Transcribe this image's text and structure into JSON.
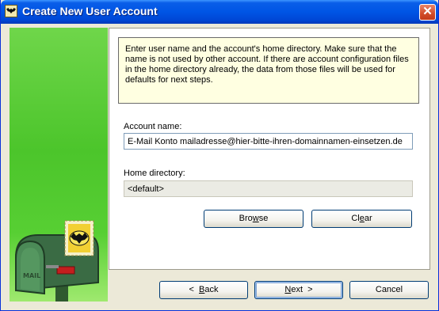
{
  "window": {
    "title": "Create New User Account",
    "close_glyph": "✕",
    "icon": "the-bat-icon"
  },
  "sidebar": {
    "mailbox_text": "MAIL",
    "image": "green-mailbox-with-bat-stamp"
  },
  "info_text": "Enter user name and the account's home directory. Make sure that the name is not used by other account. If there are account configuration files in the home directory already, the data from those files will be used for defaults for next steps.",
  "account": {
    "label": "Account name:",
    "value": "E-Mail Konto mailadresse@hier-bitte-ihren-domainnamen-einsetzen.de"
  },
  "home": {
    "label": "Home directory:",
    "value": "<default>"
  },
  "buttons": {
    "browse": {
      "pre": "Bro",
      "ul": "w",
      "post": "se"
    },
    "clear": {
      "pre": "Cl",
      "ul": "e",
      "post": "ar"
    },
    "back": {
      "pre": "<  ",
      "ul": "B",
      "post": "ack"
    },
    "next": {
      "pre": "",
      "ul": "N",
      "post": "ext  >"
    },
    "cancel": {
      "label": "Cancel"
    }
  },
  "colors": {
    "titlebar": "#0055e5",
    "info_bg": "#ffffe1",
    "sidebar_green": "#4cc52b",
    "close_red": "#d14a27"
  }
}
